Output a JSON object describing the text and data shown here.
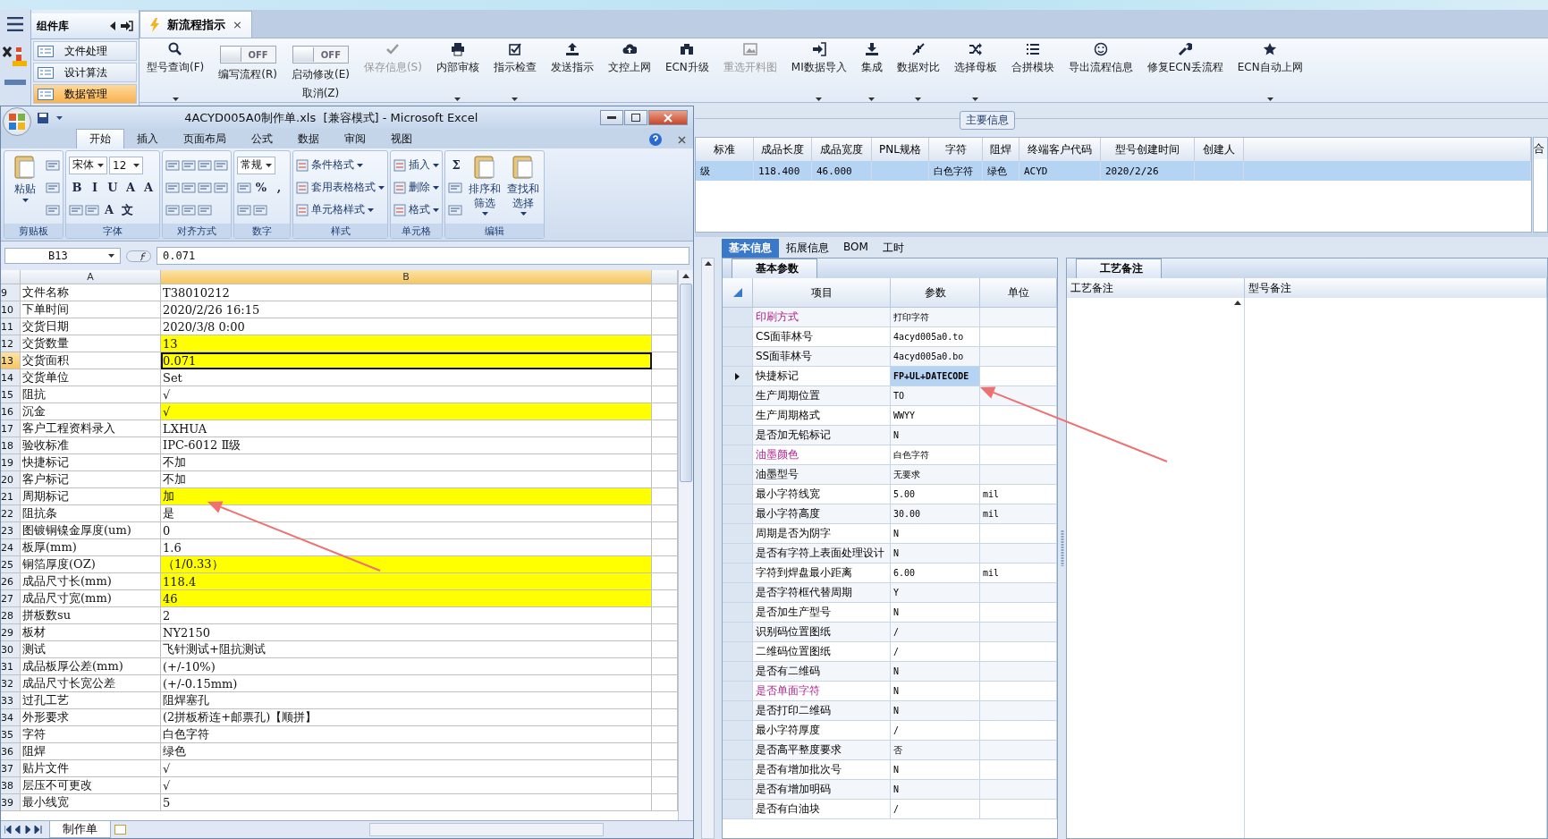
{
  "sidebar": {
    "title": "组件库",
    "items": [
      {
        "label": "文件处理",
        "selected": false
      },
      {
        "label": "设计算法",
        "selected": false
      },
      {
        "label": "数据管理",
        "selected": true
      }
    ]
  },
  "document_tabs": [
    {
      "label": "新流程指示",
      "selected": true,
      "close": "×"
    }
  ],
  "toolbar": [
    {
      "kind": "button",
      "label": "型号查询(F)",
      "dropdown": true,
      "disabled": false
    },
    {
      "kind": "toggle",
      "label": "编写流程(R)",
      "switch_text": "OFF",
      "on": false
    },
    {
      "kind": "toggle",
      "label": "启动修改(E)",
      "sublabel": "取消(Z)",
      "switch_text": "OFF",
      "on": false
    },
    {
      "kind": "button",
      "label": "保存信息(S)",
      "dropdown": false,
      "disabled": true
    },
    {
      "kind": "button",
      "label": "内部审核",
      "dropdown": true,
      "disabled": false
    },
    {
      "kind": "button",
      "label": "指示检查",
      "dropdown": true,
      "disabled": false
    },
    {
      "kind": "button",
      "label": "发送指示",
      "dropdown": false,
      "disabled": false
    },
    {
      "kind": "button",
      "label": "文控上网",
      "dropdown": false,
      "disabled": false
    },
    {
      "kind": "button",
      "label": "ECN升级",
      "dropdown": false,
      "disabled": false
    },
    {
      "kind": "button",
      "label": "重选开料图",
      "dropdown": false,
      "disabled": true
    },
    {
      "kind": "button",
      "label": "MI数据导入",
      "dropdown": true,
      "disabled": false
    },
    {
      "kind": "button",
      "label": "集成",
      "dropdown": true,
      "disabled": false
    },
    {
      "kind": "button",
      "label": "数据对比",
      "dropdown": true,
      "disabled": false
    },
    {
      "kind": "button",
      "label": "选择母板",
      "dropdown": true,
      "disabled": false
    },
    {
      "kind": "button",
      "label": "合拼模块",
      "dropdown": false,
      "disabled": false
    },
    {
      "kind": "button",
      "label": "导出流程信息",
      "dropdown": false,
      "disabled": false
    },
    {
      "kind": "button",
      "label": "修复ECN丢流程",
      "dropdown": false,
      "disabled": false
    },
    {
      "kind": "button",
      "label": "ECN自动上网",
      "dropdown": true,
      "disabled": false
    }
  ],
  "excel": {
    "title": "4ACYD005A0制作单.xls  [兼容模式] - Microsoft Excel",
    "ribbon_tabs": [
      {
        "label": "开始",
        "selected": true
      },
      {
        "label": "插入",
        "selected": false
      },
      {
        "label": "页面布局",
        "selected": false
      },
      {
        "label": "公式",
        "selected": false
      },
      {
        "label": "数据",
        "selected": false
      },
      {
        "label": "审阅",
        "selected": false
      },
      {
        "label": "视图",
        "selected": false
      }
    ],
    "groups": [
      {
        "name": "剪贴板",
        "kind": "large_first",
        "large": [
          {
            "label": "粘贴",
            "dropdown": true
          }
        ],
        "rows": [
          [
            {
              "kind": "icon"
            }
          ],
          [
            {
              "kind": "icon"
            }
          ],
          [
            {
              "kind": "icon"
            }
          ]
        ]
      },
      {
        "name": "字体",
        "kind": "small",
        "rows": [
          [
            {
              "kind": "combo",
              "label": "宋体"
            },
            {
              "kind": "combo",
              "label": "12"
            }
          ],
          [
            {
              "kind": "glyph",
              "label": "B"
            },
            {
              "kind": "glyph",
              "label": "I"
            },
            {
              "kind": "glyph",
              "label": "U"
            },
            {
              "kind": "glyph",
              "label": "A"
            },
            {
              "kind": "glyph",
              "label": "A"
            }
          ],
          [
            {
              "kind": "icon"
            },
            {
              "kind": "icon"
            },
            {
              "kind": "glyph",
              "label": "A"
            },
            {
              "kind": "glyph",
              "label": "文"
            }
          ]
        ]
      },
      {
        "name": "对齐方式",
        "kind": "small",
        "rows": [
          [
            {
              "kind": "icon"
            },
            {
              "kind": "icon"
            },
            {
              "kind": "icon"
            },
            {
              "kind": "icon"
            }
          ],
          [
            {
              "kind": "icon"
            },
            {
              "kind": "icon"
            },
            {
              "kind": "icon"
            },
            {
              "kind": "icon"
            }
          ],
          [
            {
              "kind": "icon"
            },
            {
              "kind": "icon"
            },
            {
              "kind": "icon"
            }
          ]
        ]
      },
      {
        "name": "数字",
        "kind": "small",
        "rows": [
          [
            {
              "kind": "combo",
              "label": "常规"
            }
          ],
          [
            {
              "kind": "icon"
            },
            {
              "kind": "glyph",
              "label": "%"
            },
            {
              "kind": "glyph",
              "label": ","
            }
          ],
          [
            {
              "kind": "icon"
            },
            {
              "kind": "icon"
            }
          ]
        ]
      },
      {
        "name": "样式",
        "kind": "small",
        "rows": [
          [
            {
              "kind": "menu",
              "label": "条件格式"
            }
          ],
          [
            {
              "kind": "menu",
              "label": "套用表格格式"
            }
          ],
          [
            {
              "kind": "menu",
              "label": "单元格样式"
            }
          ]
        ]
      },
      {
        "name": "单元格",
        "kind": "small",
        "rows": [
          [
            {
              "kind": "menu",
              "label": "插入"
            }
          ],
          [
            {
              "kind": "menu",
              "label": "删除"
            }
          ],
          [
            {
              "kind": "menu",
              "label": "格式"
            }
          ]
        ]
      },
      {
        "name": "编辑",
        "kind": "large_last",
        "rows": [
          [
            {
              "kind": "glyph",
              "label": "Σ"
            }
          ],
          [
            {
              "kind": "icon"
            }
          ],
          [
            {
              "kind": "icon"
            }
          ]
        ],
        "large": [
          {
            "label": "排序和筛选",
            "dropdown": true
          },
          {
            "label": "查找和选择",
            "dropdown": true
          }
        ]
      }
    ],
    "name_box": "B13",
    "formula": "0.071",
    "columns": [
      {
        "label": "A",
        "selected": false
      },
      {
        "label": "B",
        "selected": true
      }
    ],
    "rows": [
      {
        "number": "9",
        "a": "文件名称",
        "b": "T38010212",
        "highlighted": false,
        "selected": false
      },
      {
        "number": "10",
        "a": "下单时间",
        "b": "2020/2/26 16:15",
        "highlighted": false,
        "selected": false
      },
      {
        "number": "11",
        "a": "交货日期",
        "b": "2020/3/8 0:00",
        "highlighted": false,
        "selected": false
      },
      {
        "number": "12",
        "a": "交货数量",
        "b": "13",
        "highlighted": true,
        "selected": false
      },
      {
        "number": "13",
        "a": "交货面积",
        "b": "0.071",
        "highlighted": true,
        "selected": true
      },
      {
        "number": "14",
        "a": "交货单位",
        "b": "Set",
        "highlighted": false,
        "selected": false
      },
      {
        "number": "15",
        "a": "阻抗",
        "b": "√",
        "highlighted": false,
        "selected": false
      },
      {
        "number": "16",
        "a": "沉金",
        "b": "√",
        "highlighted": true,
        "selected": false
      },
      {
        "number": "17",
        "a": "客户工程资料录入",
        "b": "LXHUA",
        "highlighted": false,
        "selected": false
      },
      {
        "number": "18",
        "a": "验收标准",
        "b": "IPC-6012 Ⅱ级",
        "highlighted": false,
        "selected": false
      },
      {
        "number": "19",
        "a": "快捷标记",
        "b": "不加",
        "highlighted": false,
        "selected": false
      },
      {
        "number": "20",
        "a": "客户标记",
        "b": "不加",
        "highlighted": false,
        "selected": false
      },
      {
        "number": "21",
        "a": "周期标记",
        "b": "加",
        "highlighted": true,
        "selected": false
      },
      {
        "number": "22",
        "a": "阻抗条",
        "b": "是",
        "highlighted": false,
        "selected": false
      },
      {
        "number": "23",
        "a": "图镀铜镍金厚度(um)",
        "b": "0",
        "highlighted": false,
        "selected": false
      },
      {
        "number": "24",
        "a": "板厚(mm)",
        "b": "1.6",
        "highlighted": false,
        "selected": false
      },
      {
        "number": "25",
        "a": "铜箔厚度(OZ)",
        "b": "（1/0.33）",
        "highlighted": true,
        "selected": false
      },
      {
        "number": "26",
        "a": "成品尺寸长(mm)",
        "b": "118.4",
        "highlighted": true,
        "selected": false
      },
      {
        "number": "27",
        "a": "成品尺寸宽(mm)",
        "b": "46",
        "highlighted": true,
        "selected": false
      },
      {
        "number": "28",
        "a": "拼板数su",
        "b": "2",
        "highlighted": false,
        "selected": false
      },
      {
        "number": "29",
        "a": "板材",
        "b": "NY2150",
        "highlighted": false,
        "selected": false
      },
      {
        "number": "30",
        "a": "测试",
        "b": "飞针测试+阻抗测试",
        "highlighted": false,
        "selected": false
      },
      {
        "number": "31",
        "a": "成品板厚公差(mm)",
        "b": "(+/-10%)",
        "highlighted": false,
        "selected": false
      },
      {
        "number": "32",
        "a": "成品尺寸长宽公差",
        "b": "(+/-0.15mm)",
        "highlighted": false,
        "selected": false
      },
      {
        "number": "33",
        "a": "过孔工艺",
        "b": "阻焊塞孔",
        "highlighted": false,
        "selected": false
      },
      {
        "number": "34",
        "a": "外形要求",
        "b": "(2拼板桥连+邮票孔)【顺拼】",
        "highlighted": false,
        "selected": false
      },
      {
        "number": "35",
        "a": "字符",
        "b": "白色字符",
        "highlighted": false,
        "selected": false
      },
      {
        "number": "36",
        "a": "阻焊",
        "b": "绿色",
        "highlighted": false,
        "selected": false
      },
      {
        "number": "37",
        "a": "贴片文件",
        "b": "√",
        "highlighted": false,
        "selected": false
      },
      {
        "number": "38",
        "a": "层压不可更改",
        "b": "√",
        "highlighted": false,
        "selected": false
      },
      {
        "number": "39",
        "a": "最小线宽",
        "b": "5",
        "highlighted": false,
        "selected": false
      }
    ],
    "sheet_tabs": [
      {
        "label": "制作单",
        "selected": true
      }
    ]
  },
  "main_info": {
    "title": "主要信息",
    "columns": [
      "标准",
      "成品长度",
      "成品宽度",
      "PNL规格",
      "字符",
      "阻焊",
      "终端客户代码",
      "型号创建时间",
      "创建人"
    ],
    "rows": [
      {
        "selected": true,
        "cells": [
          "级",
          "118.400",
          "46.000",
          null,
          "白色字符",
          "绿色",
          "ACYD",
          "2020/2/26",
          null
        ]
      }
    ],
    "side_header": "合"
  },
  "detail_tabs": [
    {
      "label": "基本信息",
      "selected": true
    },
    {
      "label": "拓展信息",
      "selected": false
    },
    {
      "label": "BOM",
      "selected": false
    },
    {
      "label": "工时",
      "selected": false
    }
  ],
  "basic_params": {
    "title": "基本参数",
    "columns": [
      "项目",
      "参数",
      "单位"
    ],
    "rows": [
      {
        "item": "印刷方式",
        "value": "打印字符",
        "emphasized": true,
        "current": false
      },
      {
        "item": "CS面菲林号",
        "value": "4acyd005a0.to",
        "emphasized": false,
        "current": false
      },
      {
        "item": "SS面菲林号",
        "value": "4acyd005a0.bo",
        "emphasized": false,
        "current": false
      },
      {
        "item": "快捷标记",
        "value": "FP+UL+DATECODE",
        "emphasized": false,
        "current": true
      },
      {
        "item": "生产周期位置",
        "value": "TO",
        "emphasized": false,
        "current": false
      },
      {
        "item": "生产周期格式",
        "value": "WWYY",
        "emphasized": false,
        "current": false
      },
      {
        "item": "是否加无铅标记",
        "value": "N",
        "emphasized": false,
        "current": false
      },
      {
        "item": "油墨颜色",
        "value": "白色字符",
        "emphasized": true,
        "current": false
      },
      {
        "item": "油墨型号",
        "value": "无要求",
        "emphasized": false,
        "current": false
      },
      {
        "item": "最小字符线宽",
        "value": "5.00",
        "unit": "mil",
        "emphasized": false,
        "current": false
      },
      {
        "item": "最小字符高度",
        "value": "30.00",
        "unit": "mil",
        "emphasized": false,
        "current": false
      },
      {
        "item": "周期是否为阴字",
        "value": "N",
        "emphasized": false,
        "current": false
      },
      {
        "item": "是否有字符上表面处理设计",
        "value": "N",
        "emphasized": false,
        "current": false
      },
      {
        "item": "字符到焊盘最小距离",
        "value": "6.00",
        "unit": "mil",
        "emphasized": false,
        "current": false
      },
      {
        "item": "是否字符框代替周期",
        "value": "Y",
        "emphasized": false,
        "current": false
      },
      {
        "item": "是否加生产型号",
        "value": "N",
        "emphasized": false,
        "current": false
      },
      {
        "item": "识别码位置图纸",
        "value": "/",
        "emphasized": false,
        "current": false
      },
      {
        "item": "二维码位置图纸",
        "value": "/",
        "emphasized": false,
        "current": false
      },
      {
        "item": "是否有二维码",
        "value": "N",
        "emphasized": false,
        "current": false
      },
      {
        "item": "是否单面字符",
        "value": "N",
        "emphasized": true,
        "current": false
      },
      {
        "item": "是否打印二维码",
        "value": "N",
        "emphasized": false,
        "current": false
      },
      {
        "item": "最小字符厚度",
        "value": "/",
        "emphasized": false,
        "current": false
      },
      {
        "item": "是否高平整度要求",
        "value": "否",
        "emphasized": false,
        "current": false
      },
      {
        "item": "是否有增加批次号",
        "value": "N",
        "emphasized": false,
        "current": false
      },
      {
        "item": "是否有增加明码",
        "value": "N",
        "emphasized": false,
        "current": false
      },
      {
        "item": "是否有白油块",
        "value": "/",
        "emphasized": false,
        "current": false
      }
    ]
  },
  "process_notes": {
    "title": "工艺备注",
    "columns": [
      "工艺备注",
      "型号备注"
    ]
  }
}
